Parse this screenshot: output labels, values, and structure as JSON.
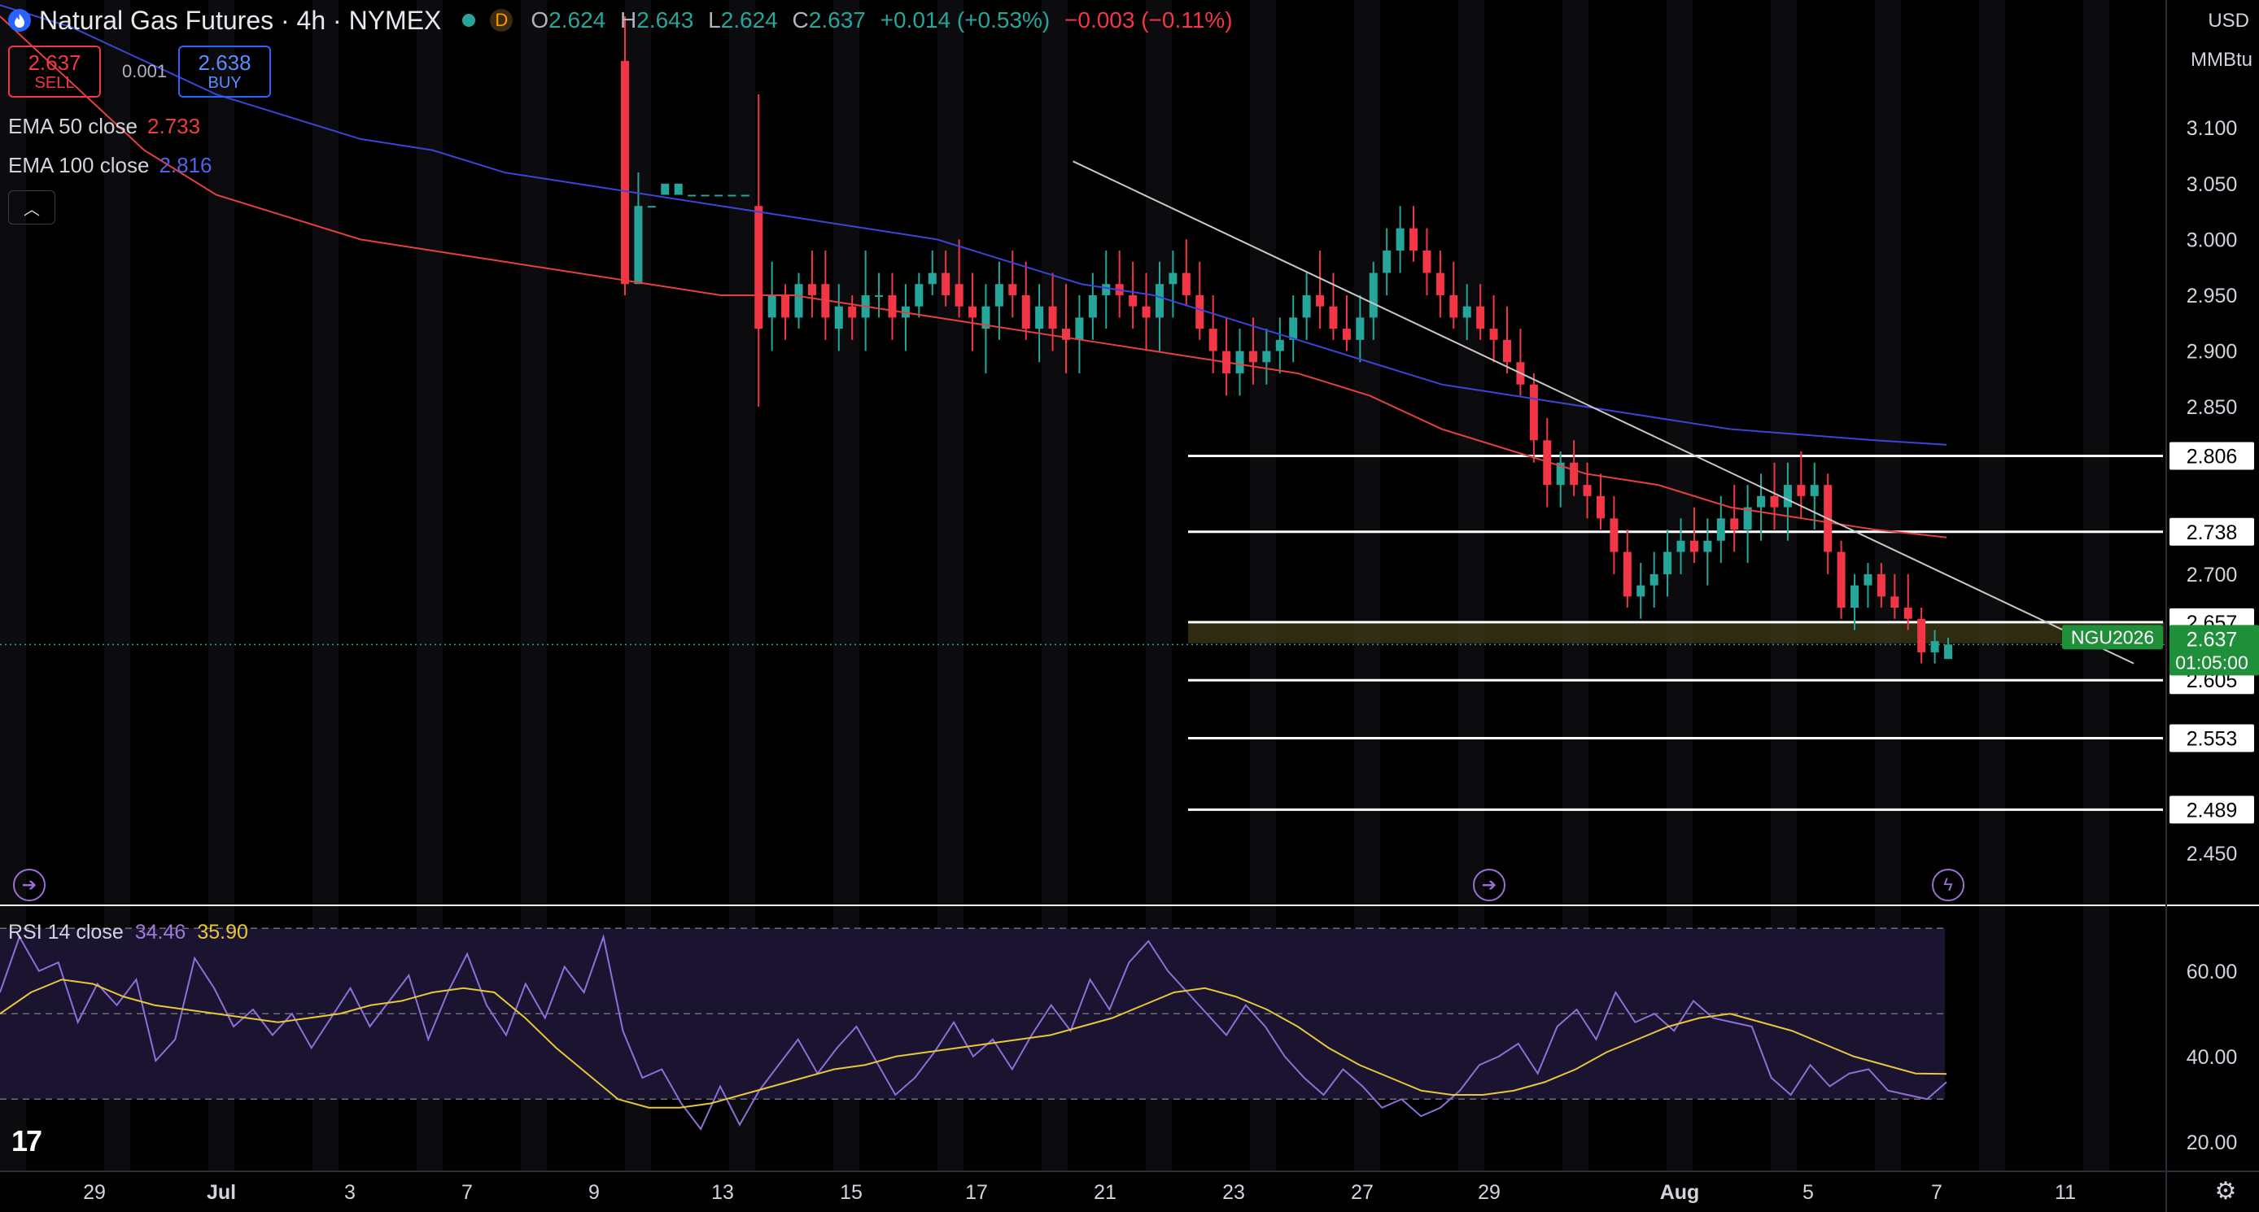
{
  "header": {
    "title": "Natural Gas Futures · 4h · NYMEX",
    "badge": "D",
    "ohlc": [
      {
        "label": "O",
        "value": "2.624"
      },
      {
        "label": "H",
        "value": "2.643"
      },
      {
        "label": "L",
        "value": "2.624"
      },
      {
        "label": "C",
        "value": "2.637"
      }
    ],
    "change": "+0.014 (+0.53%)",
    "change2": "−0.003 (−0.11%)"
  },
  "trade": {
    "sell_price": "2.637",
    "sell_label": "SELL",
    "spread": "0.001",
    "buy_price": "2.638",
    "buy_label": "BUY"
  },
  "indicators": {
    "ema50": {
      "label": "EMA 50 close",
      "value": "2.733"
    },
    "ema100": {
      "label": "EMA 100 close",
      "value": "2.816"
    },
    "rsi": {
      "label": "RSI 14 close",
      "value": "34.46",
      "ma": "35.90"
    }
  },
  "axis_unit": {
    "currency": "USD",
    "unit": "MMBtu"
  },
  "colors": {
    "up": "#26a69a",
    "down": "#f23645",
    "ema50": "#e5403f",
    "ema100": "#3a45d8",
    "rsi": "#8e6fd8",
    "rsi_ma": "#e8c63a",
    "level": "#ffffff"
  },
  "chart_data": {
    "type": "candlestick",
    "timeframe": "4h",
    "ylim": [
      2.42,
      3.2
    ],
    "y_ticks": [
      "3.100",
      "3.050",
      "3.000",
      "2.950",
      "2.900",
      "2.850",
      "2.700",
      "2.450"
    ],
    "x_ticks": [
      "29",
      "Jul",
      "3",
      "7",
      "9",
      "13",
      "15",
      "17",
      "21",
      "23",
      "27",
      "29",
      "Aug",
      "5",
      "7",
      "11"
    ],
    "price_label": {
      "symbol": "NGU2026",
      "price": "2.637",
      "countdown": "01:05:00"
    },
    "horizontal_levels": [
      2.806,
      2.738,
      2.657,
      2.605,
      2.553,
      2.489
    ],
    "level_labels": [
      "2.806",
      "2.738",
      "2.657",
      "2.605",
      "2.553",
      "2.489"
    ],
    "candles": [
      [
        3.16,
        3.2,
        2.95,
        2.96
      ],
      [
        2.96,
        2.98,
        3.06,
        3.03
      ],
      [
        3.03,
        3.05,
        3.05,
        3.03
      ],
      [
        3.04,
        3.06,
        3.06,
        3.05
      ],
      [
        3.04,
        3.06,
        3.06,
        3.05
      ],
      [
        3.04,
        3.01,
        3.01,
        3.04
      ],
      [
        3.04,
        3.04,
        3.04,
        3.04
      ],
      [
        3.04,
        3.03,
        3.03,
        3.04
      ],
      [
        3.04,
        3.04,
        3.04,
        3.04
      ],
      [
        3.04,
        3.04,
        3.04,
        3.04
      ],
      [
        3.03,
        3.13,
        2.85,
        2.92
      ],
      [
        2.93,
        2.98,
        2.9,
        2.95
      ],
      [
        2.95,
        2.96,
        2.91,
        2.93
      ],
      [
        2.93,
        2.97,
        2.92,
        2.96
      ],
      [
        2.96,
        2.99,
        2.93,
        2.95
      ],
      [
        2.96,
        2.99,
        2.91,
        2.93
      ],
      [
        2.92,
        2.96,
        2.9,
        2.94
      ],
      [
        2.94,
        2.95,
        2.91,
        2.93
      ],
      [
        2.93,
        2.99,
        2.9,
        2.95
      ],
      [
        2.95,
        2.97,
        2.93,
        2.95
      ],
      [
        2.95,
        2.97,
        2.91,
        2.93
      ],
      [
        2.93,
        2.96,
        2.9,
        2.94
      ],
      [
        2.94,
        2.97,
        2.93,
        2.96
      ],
      [
        2.96,
        2.99,
        2.95,
        2.97
      ],
      [
        2.97,
        2.99,
        2.94,
        2.95
      ],
      [
        2.96,
        3.0,
        2.93,
        2.94
      ],
      [
        2.94,
        2.97,
        2.9,
        2.93
      ],
      [
        2.92,
        2.96,
        2.88,
        2.94
      ],
      [
        2.94,
        2.98,
        2.91,
        2.96
      ],
      [
        2.96,
        2.99,
        2.93,
        2.95
      ],
      [
        2.95,
        2.98,
        2.91,
        2.92
      ],
      [
        2.92,
        2.96,
        2.89,
        2.94
      ],
      [
        2.94,
        2.97,
        2.9,
        2.92
      ],
      [
        2.92,
        2.96,
        2.88,
        2.91
      ],
      [
        2.91,
        2.95,
        2.88,
        2.93
      ],
      [
        2.93,
        2.97,
        2.91,
        2.95
      ],
      [
        2.95,
        2.99,
        2.92,
        2.96
      ],
      [
        2.96,
        2.99,
        2.93,
        2.95
      ],
      [
        2.95,
        2.98,
        2.92,
        2.94
      ],
      [
        2.94,
        2.97,
        2.9,
        2.93
      ],
      [
        2.93,
        2.98,
        2.9,
        2.96
      ],
      [
        2.96,
        2.99,
        2.93,
        2.97
      ],
      [
        2.97,
        3.0,
        2.94,
        2.95
      ],
      [
        2.95,
        2.98,
        2.91,
        2.92
      ],
      [
        2.92,
        2.95,
        2.88,
        2.9
      ],
      [
        2.9,
        2.93,
        2.86,
        2.88
      ],
      [
        2.88,
        2.92,
        2.86,
        2.9
      ],
      [
        2.9,
        2.93,
        2.87,
        2.89
      ],
      [
        2.89,
        2.92,
        2.87,
        2.9
      ],
      [
        2.9,
        2.93,
        2.88,
        2.91
      ],
      [
        2.91,
        2.95,
        2.89,
        2.93
      ],
      [
        2.93,
        2.97,
        2.91,
        2.95
      ],
      [
        2.95,
        2.99,
        2.92,
        2.94
      ],
      [
        2.94,
        2.97,
        2.91,
        2.92
      ],
      [
        2.92,
        2.95,
        2.9,
        2.91
      ],
      [
        2.91,
        2.95,
        2.89,
        2.93
      ],
      [
        2.93,
        2.98,
        2.91,
        2.97
      ],
      [
        2.97,
        3.01,
        2.95,
        2.99
      ],
      [
        2.99,
        3.03,
        2.97,
        3.01
      ],
      [
        3.01,
        3.03,
        2.98,
        2.99
      ],
      [
        2.99,
        3.01,
        2.95,
        2.97
      ],
      [
        2.97,
        2.99,
        2.93,
        2.95
      ],
      [
        2.95,
        2.98,
        2.92,
        2.93
      ],
      [
        2.93,
        2.96,
        2.91,
        2.94
      ],
      [
        2.94,
        2.96,
        2.91,
        2.92
      ],
      [
        2.92,
        2.95,
        2.89,
        2.91
      ],
      [
        2.91,
        2.94,
        2.88,
        2.89
      ],
      [
        2.89,
        2.92,
        2.86,
        2.87
      ],
      [
        2.87,
        2.88,
        2.8,
        2.82
      ],
      [
        2.82,
        2.84,
        2.76,
        2.78
      ],
      [
        2.78,
        2.81,
        2.76,
        2.8
      ],
      [
        2.8,
        2.82,
        2.77,
        2.78
      ],
      [
        2.78,
        2.8,
        2.75,
        2.77
      ],
      [
        2.77,
        2.79,
        2.74,
        2.75
      ],
      [
        2.75,
        2.77,
        2.7,
        2.72
      ],
      [
        2.72,
        2.74,
        2.67,
        2.68
      ],
      [
        2.68,
        2.71,
        2.66,
        2.69
      ],
      [
        2.69,
        2.72,
        2.67,
        2.7
      ],
      [
        2.7,
        2.74,
        2.68,
        2.72
      ],
      [
        2.72,
        2.75,
        2.7,
        2.73
      ],
      [
        2.73,
        2.76,
        2.71,
        2.72
      ],
      [
        2.72,
        2.75,
        2.69,
        2.73
      ],
      [
        2.73,
        2.77,
        2.71,
        2.75
      ],
      [
        2.75,
        2.78,
        2.72,
        2.74
      ],
      [
        2.74,
        2.78,
        2.71,
        2.76
      ],
      [
        2.76,
        2.79,
        2.73,
        2.77
      ],
      [
        2.77,
        2.8,
        2.74,
        2.76
      ],
      [
        2.76,
        2.8,
        2.73,
        2.78
      ],
      [
        2.78,
        2.81,
        2.75,
        2.77
      ],
      [
        2.77,
        2.8,
        2.74,
        2.78
      ],
      [
        2.78,
        2.79,
        2.7,
        2.72
      ],
      [
        2.72,
        2.73,
        2.66,
        2.67
      ],
      [
        2.67,
        2.7,
        2.65,
        2.69
      ],
      [
        2.69,
        2.71,
        2.67,
        2.7
      ],
      [
        2.7,
        2.71,
        2.67,
        2.68
      ],
      [
        2.68,
        2.7,
        2.66,
        2.67
      ],
      [
        2.67,
        2.7,
        2.65,
        2.66
      ],
      [
        2.66,
        2.67,
        2.62,
        2.63
      ],
      [
        2.63,
        2.65,
        2.62,
        2.64
      ],
      [
        2.624,
        2.643,
        2.624,
        2.637
      ]
    ],
    "ema50": [
      3.2,
      3.14,
      3.08,
      3.04,
      3.02,
      3.0,
      2.99,
      2.98,
      2.97,
      2.96,
      2.95,
      2.95,
      2.94,
      2.93,
      2.92,
      2.91,
      2.9,
      2.89,
      2.88,
      2.86,
      2.83,
      2.81,
      2.79,
      2.78,
      2.76,
      2.75,
      2.74,
      2.733
    ],
    "ema100": [
      3.21,
      3.19,
      3.16,
      3.13,
      3.11,
      3.09,
      3.08,
      3.06,
      3.05,
      3.04,
      3.03,
      3.02,
      3.01,
      3.0,
      2.98,
      2.96,
      2.95,
      2.93,
      2.91,
      2.89,
      2.87,
      2.86,
      2.85,
      2.84,
      2.83,
      2.825,
      2.82,
      2.816
    ],
    "trendline": {
      "from": [
        0.475,
        3.07
      ],
      "to": [
        0.985,
        2.62
      ]
    },
    "rsi": {
      "ylim": [
        15,
        75
      ],
      "y_ticks": [
        "60.00",
        "40.00",
        "20.00"
      ],
      "bands": [
        70,
        50,
        30
      ],
      "values": [
        55,
        68,
        60,
        62,
        48,
        57,
        52,
        58,
        39,
        44,
        63,
        56,
        47,
        51,
        45,
        50,
        42,
        49,
        56,
        47,
        53,
        59,
        44,
        55,
        64,
        52,
        45,
        57,
        49,
        61,
        55,
        68,
        46,
        35,
        37,
        29,
        23,
        33,
        24,
        32,
        38,
        44,
        36,
        42,
        47,
        39,
        31,
        35,
        41,
        48,
        40,
        44,
        37,
        45,
        52,
        46,
        58,
        51,
        62,
        67,
        60,
        55,
        50,
        45,
        52,
        47,
        40,
        35,
        31,
        37,
        33,
        28,
        30,
        26,
        28,
        32,
        38,
        40,
        43,
        36,
        47,
        51,
        44,
        55,
        48,
        50,
        46,
        53,
        49,
        48,
        47,
        35,
        31,
        38,
        33,
        36,
        37,
        32,
        31,
        30,
        34
      ],
      "ma": [
        50,
        55,
        58,
        57,
        54,
        52,
        51,
        50,
        49,
        48,
        49,
        50,
        52,
        53,
        55,
        56,
        55,
        49,
        42,
        36,
        30,
        28,
        28,
        29,
        31,
        33,
        35,
        37,
        38,
        40,
        41,
        42,
        43,
        44,
        45,
        47,
        49,
        52,
        55,
        56,
        54,
        51,
        47,
        42,
        38,
        35,
        32,
        31,
        31,
        32,
        34,
        37,
        41,
        44,
        47,
        49,
        50,
        48,
        46,
        43,
        40,
        38,
        36,
        35.9
      ]
    }
  }
}
